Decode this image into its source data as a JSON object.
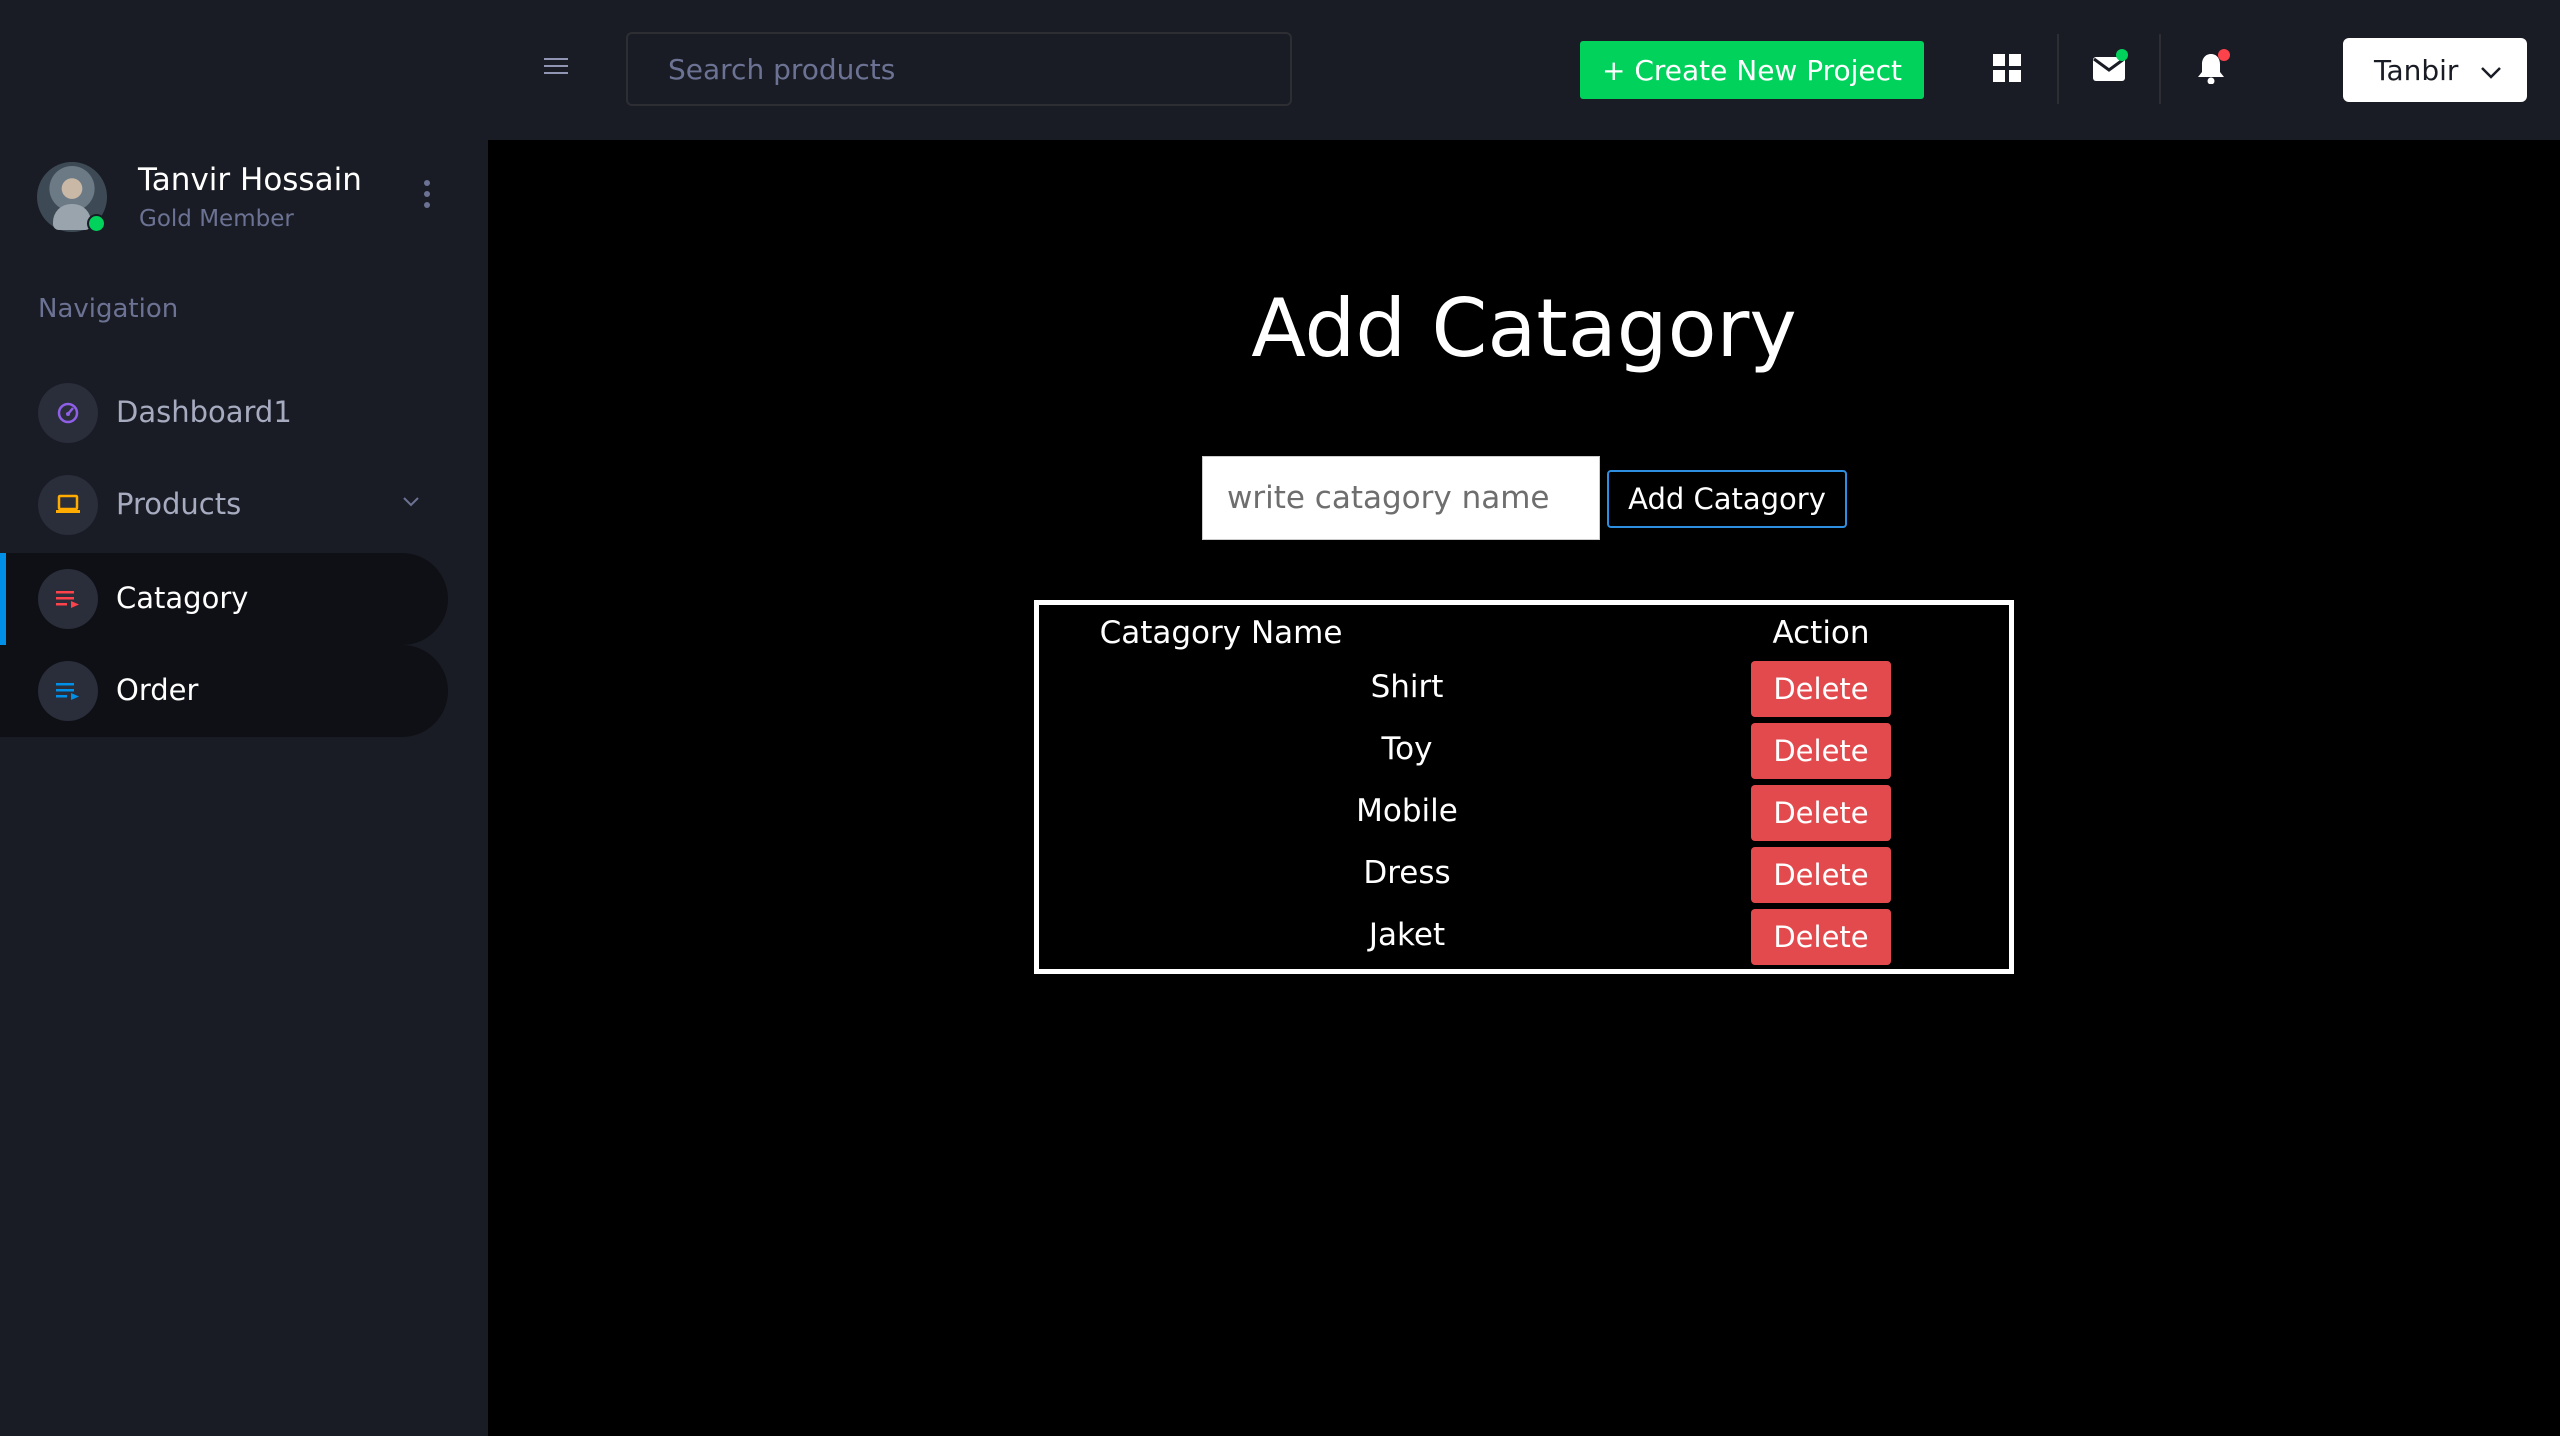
{
  "topbar": {
    "search_placeholder": "Search products",
    "create_label": "+ Create New Project",
    "user_label": "Tanbir"
  },
  "sidebar": {
    "profile": {
      "name": "Tanvir Hossain",
      "level": "Gold Member"
    },
    "heading": "Navigation",
    "items": [
      {
        "label": "Dashboard1",
        "icon": "speedometer-icon",
        "color": "#8f5fe8"
      },
      {
        "label": "Products",
        "icon": "laptop-icon",
        "color": "#ffab00"
      },
      {
        "label": "Catagory",
        "icon": "playlist-icon",
        "color": "#fc424a"
      },
      {
        "label": "Order",
        "icon": "playlist-icon",
        "color": "#0090e7"
      }
    ]
  },
  "main": {
    "title": "Add Catagory",
    "input_placeholder": "write catagory name",
    "add_button": "Add Catagory",
    "table": {
      "headers": [
        "Catagory Name",
        "Action"
      ],
      "rows": [
        {
          "name": "Shirt",
          "action": "Delete"
        },
        {
          "name": "Toy",
          "action": "Delete"
        },
        {
          "name": "Mobile",
          "action": "Delete"
        },
        {
          "name": "Dress",
          "action": "Delete"
        },
        {
          "name": "Jaket",
          "action": "Delete"
        }
      ]
    }
  },
  "colors": {
    "sidebar_bg": "#191c24",
    "main_bg": "#000000",
    "accent_green": "#00d25b",
    "delete_red": "#e34a4e",
    "active_bar": "#0090e7"
  }
}
